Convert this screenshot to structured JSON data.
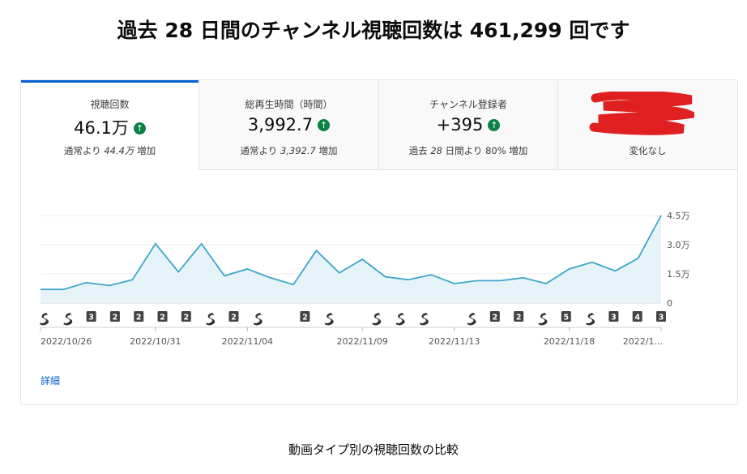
{
  "headline": "過去 28 日間のチャンネル視聴回数は 461,299 回です",
  "metrics": [
    {
      "label": "視聴回数",
      "value": "46.1万",
      "trend": "up",
      "note_prefix": "通常より",
      "note_value": "44.4万",
      "note_suffix": "増加"
    },
    {
      "label": "総再生時間（時間）",
      "value": "3,992.7",
      "trend": "up",
      "note_prefix": "通常より",
      "note_value": "3,392.7",
      "note_suffix": "増加"
    },
    {
      "label": "チャンネル登録者",
      "value": "+395",
      "trend": "up",
      "note_prefix": "過去",
      "note_value": "28",
      "note_suffix": "日間より 80% 増加"
    },
    {
      "label": "",
      "value": "",
      "note_prefix": "変化なし",
      "note_value": "",
      "note_suffix": ""
    }
  ],
  "colors": {
    "accent": "#065fd4",
    "line": "#3ea6c8",
    "area": "#e6f3f9",
    "trend_up": "#0b8043",
    "redaction": "#e02020"
  },
  "chart_data": {
    "type": "area",
    "y_ticks": [
      "4.5万",
      "3.0万",
      "1.5万",
      "0"
    ],
    "ylim": [
      0,
      45000
    ],
    "values": [
      7000,
      7000,
      10500,
      9000,
      12000,
      30500,
      16000,
      30500,
      14000,
      17500,
      13000,
      9500,
      27000,
      15500,
      22500,
      13500,
      12000,
      14500,
      10000,
      11500,
      11500,
      13000,
      10000,
      17500,
      21000,
      16500,
      23000,
      45000
    ],
    "x_labels": [
      "2022/10/26",
      "2022/10/31",
      "2022/11/04",
      "2022/11/09",
      "2022/11/13",
      "2022/11/18",
      "2022/1..."
    ],
    "markers": [
      "s",
      "s",
      "3",
      "2",
      "2",
      "2",
      "2",
      "s",
      "2",
      "s",
      "",
      "2",
      "s",
      "",
      "s",
      "s",
      "s",
      "",
      "s",
      "2",
      "2",
      "s",
      "5",
      "s",
      "3",
      "4",
      "3"
    ]
  },
  "details_link": "詳細",
  "footer_title": "動画タイプ別の視聴回数の比較"
}
